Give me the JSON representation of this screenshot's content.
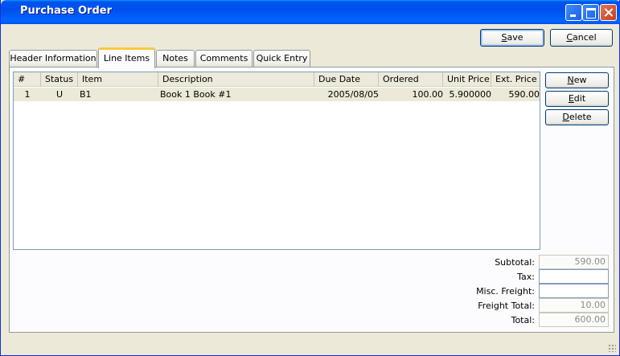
{
  "window": {
    "title": "Purchase Order"
  },
  "actions": {
    "save": "Save",
    "cancel": "Cancel"
  },
  "tabs": [
    {
      "label": "Header Information"
    },
    {
      "label": "Line Items"
    },
    {
      "label": "Notes"
    },
    {
      "label": "Comments"
    },
    {
      "label": "Quick Entry"
    }
  ],
  "grid": {
    "columns": [
      "#",
      "Status",
      "Item",
      "Description",
      "Due Date",
      "Ordered",
      "Unit Price",
      "Ext. Price"
    ],
    "rows": [
      {
        "num": "1",
        "status": "U",
        "item": "B1",
        "description": "Book 1 Book #1",
        "due_date": "2005/08/05",
        "ordered": "100.00",
        "unit_price": "5.900000",
        "ext_price": "590.00"
      }
    ]
  },
  "side_buttons": {
    "new": "New",
    "edit": "Edit",
    "delete": "Delete"
  },
  "totals": {
    "subtotal_label": "Subtotal:",
    "subtotal": "590.00",
    "tax_label": "Tax:",
    "tax": "",
    "misc_freight_label": "Misc. Freight:",
    "misc_freight": "",
    "freight_total_label": "Freight Total:",
    "freight_total": "10.00",
    "total_label": "Total:",
    "total": "600.00"
  }
}
